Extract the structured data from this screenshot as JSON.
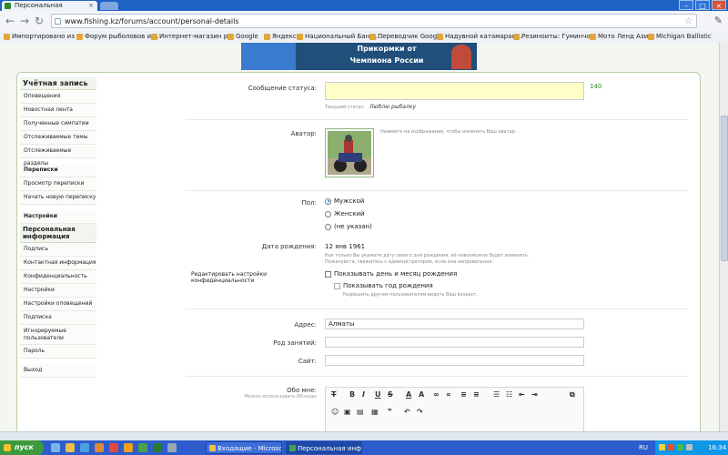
{
  "browser": {
    "tab_title": "Персональная информация",
    "url": "www.fishing.kz/forums/account/personal-details",
    "bookmarks": [
      "Импортировано из IE",
      "Форум рыболовов и ...",
      "Интернет-магазин р...",
      "Google",
      "Яндекс",
      "Национальный Банк ...",
      "Переводчик Google",
      "Надувной катамаран...",
      "Резиноиты: Гуминчо...",
      "Мото Ленд Азия",
      "Michigan Ballistic"
    ]
  },
  "banner": {
    "line1": "Прикормки от",
    "line2": "Чемпиона России"
  },
  "sidebar": {
    "account_title": "Учётная запись",
    "account_items": [
      "Оповещения",
      "Новостная лента",
      "Полученные симпатии",
      "Отслеживаемые темы",
      "Отслеживаемые разделы"
    ],
    "conversations_title": "Переписки",
    "conversations_items": [
      "Просмотр переписки",
      "Начать новую переписку"
    ],
    "settings_title": "Настройки",
    "personal_title": "Персональная информация",
    "personal_items": [
      "Подпись",
      "Контактная информация",
      "Конфиденциальность",
      "Настройки",
      "Настройки оповещений",
      "Подписка",
      "Игнорируемые пользователи",
      "Пароль"
    ],
    "logout": "Выход"
  },
  "form": {
    "status_label": "Сообщение статуса:",
    "status_counter": "140",
    "current_status_label": "Текущий статус:",
    "current_status_value": "Люблю рыбалку",
    "avatar_label": "Аватар:",
    "avatar_hint": "Нажмите на изображение, чтобы изменить Ваш аватар.",
    "gender_label": "Пол:",
    "gender_options": [
      "Мужской",
      "Женский",
      "(не указан)"
    ],
    "gender_selected": 0,
    "birthday_label": "Дата рождения:",
    "birthday_value": "12 янв 1961",
    "birthday_note1": "Как только Вы укажете дату своего дня рождения, её невозможно будет изменить.",
    "birthday_note2": "Пожалуйста, свяжитесь с администратором, если она неправильная.",
    "privacy_label": "Редактировать настройки конфиденциальности",
    "privacy_checkbox1": "Показывать день и месяц рождения",
    "privacy_checkbox2": "Показывать год рождения",
    "privacy_note": "Разрешить другим пользователям видеть Ваш возраст.",
    "address_label": "Адрес:",
    "address_value": "Алматы",
    "occupation_label": "Род занятий:",
    "occupation_value": "",
    "website_label": "Сайт:",
    "website_value": "",
    "about_label": "Обо мне:",
    "about_note": "Можно использовать BB-коды"
  },
  "taskbar": {
    "start": "пуск",
    "tasks": [
      "Входящие - Microsof...",
      "Персональная инфо..."
    ],
    "lang": "RU",
    "time": "16:34"
  }
}
